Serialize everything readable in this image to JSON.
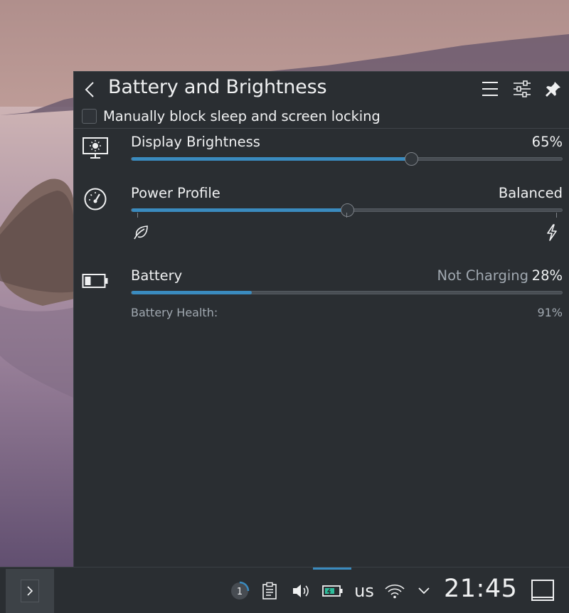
{
  "popup": {
    "title": "Battery and Brightness",
    "inhibit_label": "Manually block sleep and screen locking",
    "inhibit_checked": false,
    "header_icons": [
      "back-arrow-icon",
      "menu-icon",
      "configure-icon",
      "pin-icon"
    ]
  },
  "brightness": {
    "label": "Display Brightness",
    "value_text": "65%",
    "percent": 65,
    "icon": "display-brightness-icon"
  },
  "power_profile": {
    "label": "Power Profile",
    "value_text": "Balanced",
    "position_fraction": 0.5,
    "icon": "speedometer-icon",
    "left_icon": "leaf-icon",
    "right_icon": "lightning-icon"
  },
  "battery": {
    "label": "Battery",
    "status": "Not Charging",
    "value_text": "28%",
    "percent": 28,
    "health_label": "Battery Health:",
    "health_value": "91%",
    "icon": "battery-icon"
  },
  "taskbar": {
    "notification_count": "1",
    "keyboard_layout": "us",
    "clock": "21:45",
    "tray_icons": [
      "notifications-icon",
      "clipboard-icon",
      "volume-icon",
      "battery-tray-icon",
      "wifi-icon",
      "expand-tray-icon"
    ]
  },
  "colors": {
    "accent": "#3a8bbf",
    "popup_bg": "#2a2e32",
    "text": "#eff0f1",
    "muted_text": "#a1a9b1"
  }
}
